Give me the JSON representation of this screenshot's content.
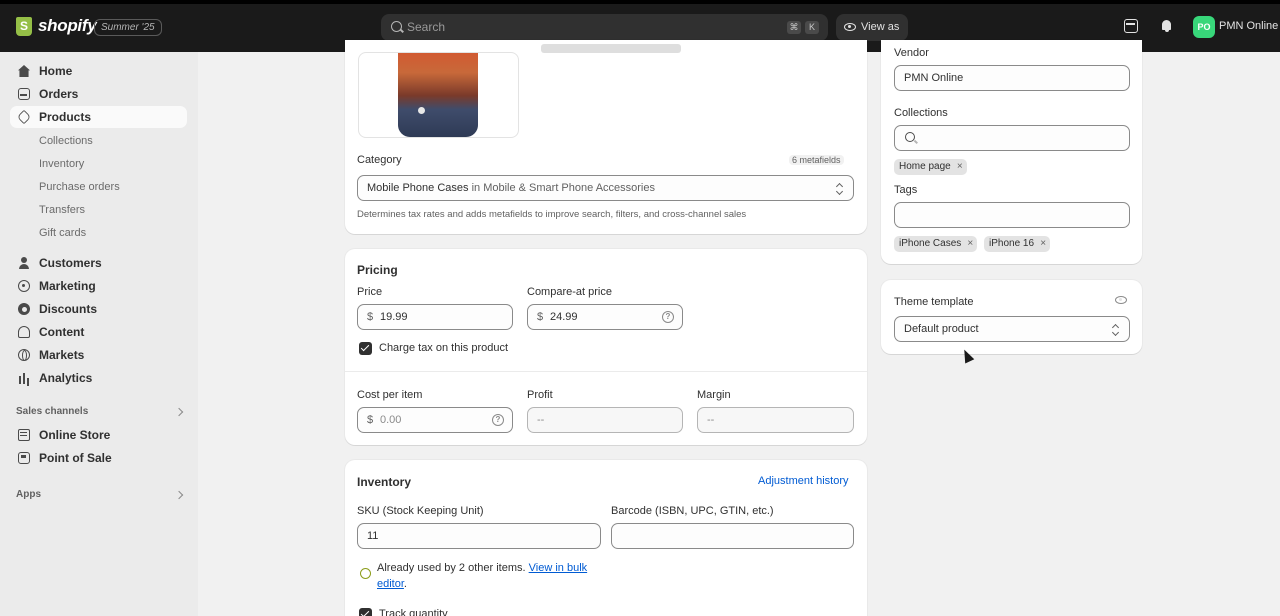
{
  "topbar": {
    "logo_text": "shopify",
    "edition": "Summer '25",
    "search_placeholder": "Search",
    "kbd1": "⌘",
    "kbd2": "K",
    "view_as": "View as",
    "avatar_initials": "PO",
    "store_name": "PMN Online"
  },
  "sidebar": {
    "items": [
      {
        "label": "Home",
        "icon": "home-icon"
      },
      {
        "label": "Orders",
        "icon": "orders-icon"
      },
      {
        "label": "Products",
        "icon": "tag-icon",
        "active": true
      }
    ],
    "product_sub": [
      "Collections",
      "Inventory",
      "Purchase orders",
      "Transfers",
      "Gift cards"
    ],
    "items2": [
      {
        "label": "Customers",
        "icon": "person-icon"
      },
      {
        "label": "Marketing",
        "icon": "target-icon"
      },
      {
        "label": "Discounts",
        "icon": "discount-icon"
      },
      {
        "label": "Content",
        "icon": "content-icon"
      },
      {
        "label": "Markets",
        "icon": "globe-icon"
      },
      {
        "label": "Analytics",
        "icon": "analytics-icon"
      }
    ],
    "sales_channels_header": "Sales channels",
    "channels": [
      {
        "label": "Online Store",
        "icon": "online-store-icon"
      },
      {
        "label": "Point of Sale",
        "icon": "point-of-sale-icon"
      }
    ],
    "apps_header": "Apps"
  },
  "category": {
    "label": "Category",
    "metafields": "6 metafields",
    "value_main": "Mobile Phone Cases",
    "value_path": " in Mobile & Smart Phone Accessories",
    "help": "Determines tax rates and adds metafields to improve search, filters, and cross-channel sales"
  },
  "pricing": {
    "title": "Pricing",
    "price_label": "Price",
    "price_currency": "$",
    "price_value": "19.99",
    "compare_label": "Compare-at price",
    "compare_currency": "$",
    "compare_value": "24.99",
    "charge_tax": "Charge tax on this product",
    "cost_label": "Cost per item",
    "cost_currency": "$",
    "cost_placeholder": "0.00",
    "profit_label": "Profit",
    "profit_value": "--",
    "margin_label": "Margin",
    "margin_value": "--"
  },
  "inventory": {
    "title": "Inventory",
    "adjustment_link": "Adjustment history",
    "sku_label": "SKU (Stock Keeping Unit)",
    "sku_value": "11",
    "barcode_label": "Barcode (ISBN, UPC, GTIN, etc.)",
    "warning_text": "Already used by 2 other items. ",
    "warning_link_1": "View in bulk",
    "warning_link_2": "editor",
    "warning_end": ".",
    "track_quantity": "Track quantity"
  },
  "organization": {
    "vendor_label": "Vendor",
    "vendor_value": "PMN Online",
    "collections_label": "Collections",
    "collections_pills": [
      "Home page"
    ],
    "tags_label": "Tags",
    "tags_pills": [
      "iPhone Cases",
      "iPhone 16"
    ]
  },
  "theme": {
    "label": "Theme template",
    "value": "Default product"
  },
  "pill_remove": "×",
  "help_glyph": "?"
}
